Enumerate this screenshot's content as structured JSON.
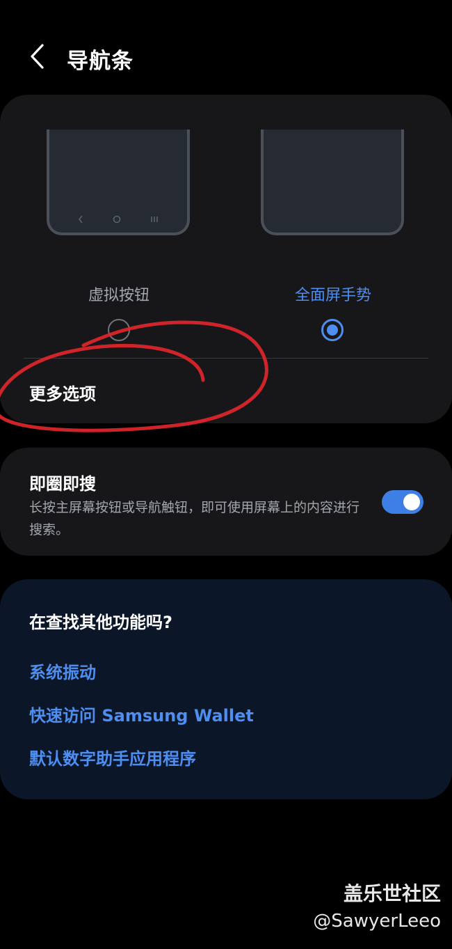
{
  "header": {
    "title": "导航条",
    "back_icon": "chevron-left-icon"
  },
  "navigation_type": {
    "options": [
      {
        "label": "虚拟按钮",
        "selected": false
      },
      {
        "label": "全面屏手势",
        "selected": true
      }
    ],
    "more_options_label": "更多选项"
  },
  "circle_to_search": {
    "title": "即圈即搜",
    "description": "长按主屏幕按钮或导航触钮，即可使用屏幕上的内容进行搜索。",
    "toggle_on": true
  },
  "suggestions": {
    "title": "在查找其他功能吗?",
    "links": [
      "系统振动",
      "快速访问 Samsung Wallet",
      "默认数字助手应用程序"
    ]
  },
  "watermark": {
    "title": "盖乐世社区",
    "handle": "@SawyerLeeo"
  },
  "colors": {
    "background": "#000000",
    "card": "#17171a",
    "accent": "#4e8ef0",
    "suggest_card": "#0b1628",
    "annotation": "#e0262b"
  }
}
